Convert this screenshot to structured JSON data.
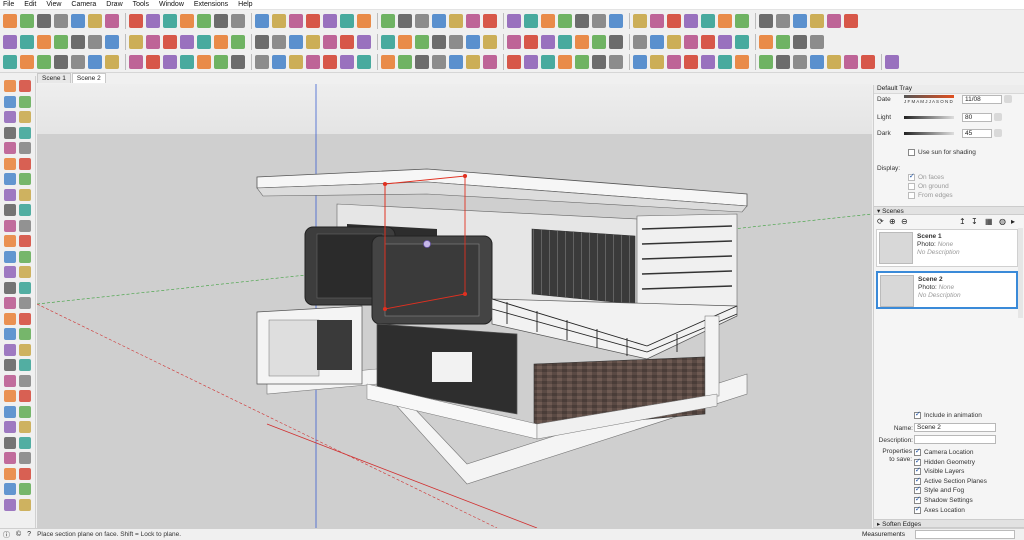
{
  "menu": [
    "File",
    "Edit",
    "View",
    "Camera",
    "Draw",
    "Tools",
    "Window",
    "Extensions",
    "Help"
  ],
  "tabs": [
    "Scene 1",
    "Scene 2"
  ],
  "tray": {
    "title": "Default Tray",
    "date_label": "Date",
    "months": "J F M A M J J A S O N D",
    "date_value": "11/08",
    "light_label": "Light",
    "light_value": "80",
    "dark_label": "Dark",
    "dark_value": "45",
    "use_sun_label": "Use sun for shading",
    "display_label": "Display:",
    "on_faces": "On faces",
    "on_ground": "On ground",
    "from_edges": "From edges",
    "scenes_header": "Scenes",
    "scenes": [
      {
        "name": "Scene 1",
        "photo": "Photo:",
        "photo_value": "None",
        "desc": "No Description"
      },
      {
        "name": "Scene 2",
        "photo": "Photo:",
        "photo_value": "None",
        "desc": "No Description"
      }
    ],
    "include_anim": "Include in animation",
    "name_label": "Name:",
    "name_value": "Scene 2",
    "description_label": "Description:",
    "properties_label": "Properties to save:",
    "properties": [
      "Camera Location",
      "Hidden Geometry",
      "Visible Layers",
      "Active Section Planes",
      "Style and Fog",
      "Shadow Settings",
      "Axes Location"
    ],
    "soften_header": "Soften Edges"
  },
  "status": {
    "text": "Place section plane on face.  Shift = Lock to plane.",
    "measurements_label": "Measurements"
  },
  "colors": {
    "accent": "#3a8ad8",
    "sky": "#e9e9e9",
    "ground": "#cfcfcf",
    "section_red": "#e03020"
  }
}
